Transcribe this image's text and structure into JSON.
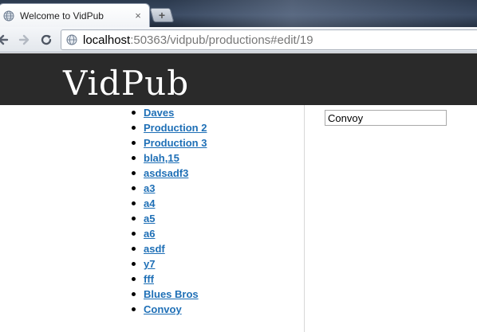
{
  "browser": {
    "tab_title": "Welcome to VidPub",
    "tab_close": "×",
    "new_tab": "+",
    "url_host": "localhost",
    "url_rest": ":50363/vidpub/productions#edit/19"
  },
  "site": {
    "brand": "VidPub"
  },
  "productions": [
    {
      "label": "Daves"
    },
    {
      "label": "Production 2"
    },
    {
      "label": "Production 3"
    },
    {
      "label": "blah,15"
    },
    {
      "label": "asdsadf3"
    },
    {
      "label": "a3"
    },
    {
      "label": "a4"
    },
    {
      "label": "a5"
    },
    {
      "label": "a6"
    },
    {
      "label": "asdf"
    },
    {
      "label": "y7"
    },
    {
      "label": "fff"
    },
    {
      "label": "Blues Bros"
    },
    {
      "label": "Convoy"
    }
  ],
  "edit": {
    "name_value": "Convoy"
  },
  "colors": {
    "link": "#1e6fb6",
    "header_bg": "#2a2a2a"
  }
}
